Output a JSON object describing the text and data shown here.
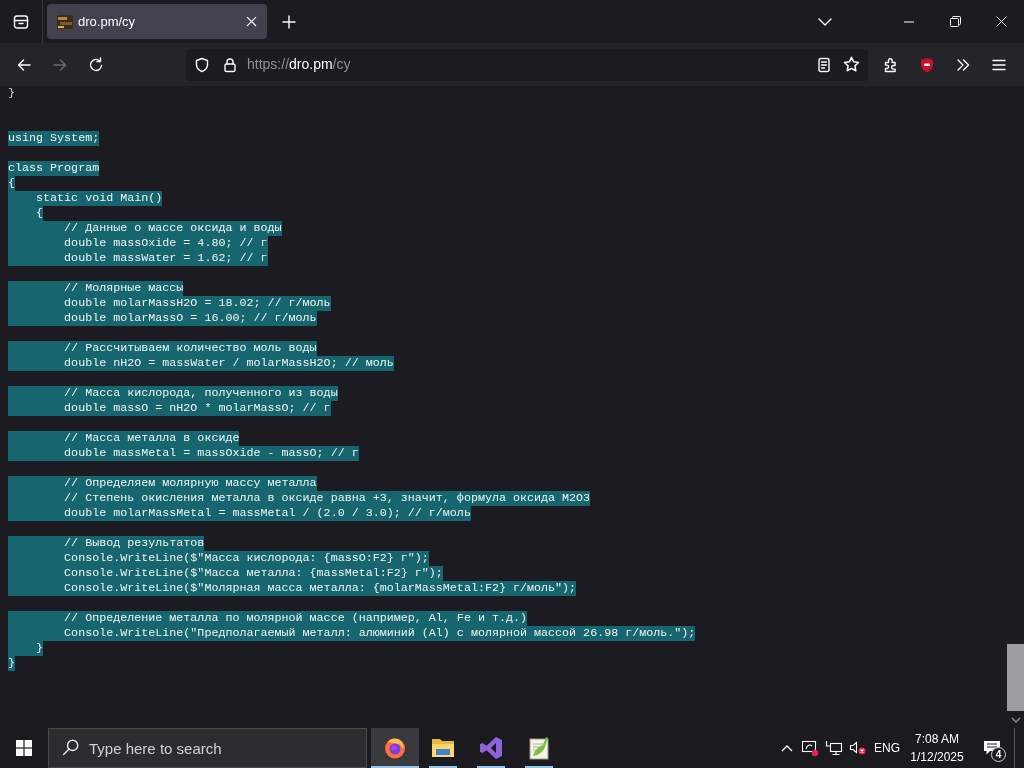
{
  "browser": {
    "tabs": [
      {
        "title": "dro.pm/cy",
        "selected": true
      }
    ],
    "nav_buttons": [
      {
        "kind": "back",
        "disabled": false
      },
      {
        "kind": "forward",
        "disabled": true
      },
      {
        "kind": "reload",
        "disabled": false
      }
    ],
    "address": {
      "scheme": "https://",
      "host": "dro.pm",
      "path": "/cy"
    }
  },
  "code": {
    "lines": [
      {
        "kind": "code",
        "text": "}",
        "selected": false
      },
      {
        "kind": "blank"
      },
      {
        "kind": "blank"
      },
      {
        "kind": "code",
        "text": "using System;",
        "selected": true
      },
      {
        "kind": "blank"
      },
      {
        "kind": "code",
        "text": "class Program",
        "selected": true
      },
      {
        "kind": "code",
        "text": "{",
        "selected": true
      },
      {
        "kind": "code",
        "text": "    static void Main()",
        "selected": true
      },
      {
        "kind": "code",
        "text": "    {",
        "selected": true
      },
      {
        "kind": "code",
        "text": "        // Данные о массе оксида и воды",
        "selected": true
      },
      {
        "kind": "code",
        "text": "        double massOxide = 4.80; // г",
        "selected": true
      },
      {
        "kind": "code",
        "text": "        double massWater = 1.62; // г",
        "selected": true
      },
      {
        "kind": "blank"
      },
      {
        "kind": "code",
        "text": "        // Молярные массы",
        "selected": true
      },
      {
        "kind": "code",
        "text": "        double molarMassH2O = 18.02; // г/моль",
        "selected": true
      },
      {
        "kind": "code",
        "text": "        double molarMassO = 16.00; // г/моль",
        "selected": true
      },
      {
        "kind": "blank"
      },
      {
        "kind": "code",
        "text": "        // Рассчитываем количество моль воды",
        "selected": true
      },
      {
        "kind": "code",
        "text": "        double nH2O = massWater / molarMassH2O; // моль",
        "selected": true
      },
      {
        "kind": "blank"
      },
      {
        "kind": "code",
        "text": "        // Масса кислорода, полученного из воды",
        "selected": true
      },
      {
        "kind": "code",
        "text": "        double massO = nH2O * molarMassO; // г",
        "selected": true
      },
      {
        "kind": "blank"
      },
      {
        "kind": "code",
        "text": "        // Масса металла в оксиде",
        "selected": true
      },
      {
        "kind": "code",
        "text": "        double massMetal = massOxide - massO; // г",
        "selected": true
      },
      {
        "kind": "blank"
      },
      {
        "kind": "code",
        "text": "        // Определяем молярную массу металла",
        "selected": true
      },
      {
        "kind": "code",
        "text": "        // Степень окисления металла в оксиде равна +3, значит, формула оксида M2O3",
        "selected": true
      },
      {
        "kind": "code",
        "text": "        double molarMassMetal = massMetal / (2.0 / 3.0); // г/моль",
        "selected": true
      },
      {
        "kind": "blank"
      },
      {
        "kind": "code",
        "text": "        // Вывод результатов",
        "selected": true
      },
      {
        "kind": "code",
        "text": "        Console.WriteLine($\"Масса кислорода: {massO:F2} г\");",
        "selected": true
      },
      {
        "kind": "code",
        "text": "        Console.WriteLine($\"Масса металла: {massMetal:F2} г\");",
        "selected": true
      },
      {
        "kind": "code",
        "text": "        Console.WriteLine($\"Молярная масса металла: {molarMassMetal:F2} г/моль\");",
        "selected": true
      },
      {
        "kind": "blank"
      },
      {
        "kind": "code",
        "text": "        // Определение металла по молярной массе (например, Al, Fe и т.д.)",
        "selected": true
      },
      {
        "kind": "code",
        "text": "        Console.WriteLine(\"Предполагаемый металл: алюминий (Al) с молярной массой 26.98 г/моль.\");",
        "selected": true
      },
      {
        "kind": "code",
        "text": "    }",
        "selected": true
      },
      {
        "kind": "code",
        "text": "}",
        "selected": true
      }
    ]
  },
  "taskbar": {
    "search": {
      "placeholder": "Type here to search"
    },
    "apps": [
      {
        "kind": "browser",
        "selected": true
      },
      {
        "kind": "files",
        "selected": false
      },
      {
        "kind": "ide",
        "selected": false
      },
      {
        "kind": "editor",
        "selected": false
      }
    ],
    "tray": {
      "language": "ENG",
      "time": "7:08 AM",
      "date": "1/12/2025",
      "notifications": "4"
    }
  }
}
